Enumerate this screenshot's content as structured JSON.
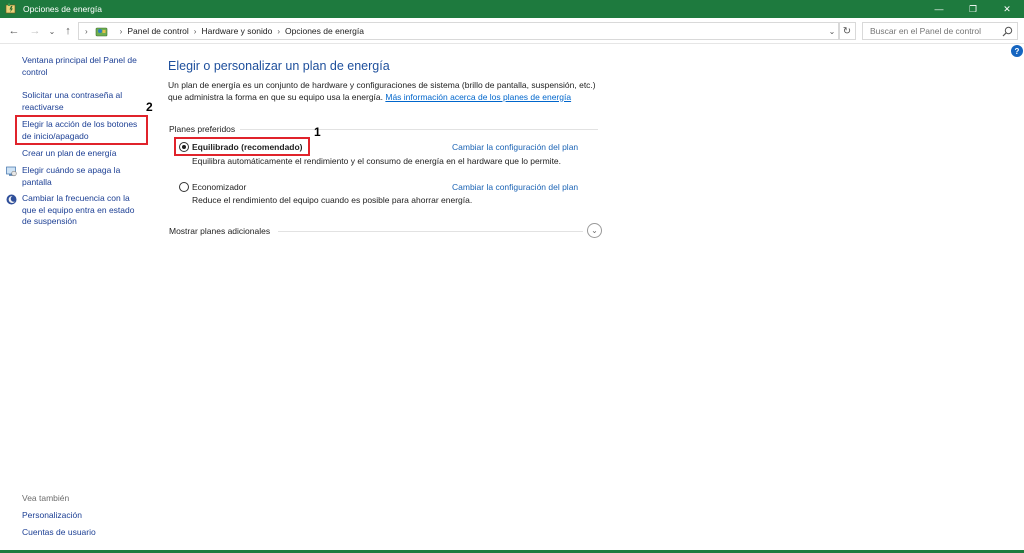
{
  "window": {
    "title": "Opciones de energía",
    "minimize": "—",
    "maximize": "❐",
    "close": "✕",
    "accent": "#1e7a3e"
  },
  "address": {
    "back": "←",
    "forward": "→",
    "history": "⌄",
    "up": "↑",
    "breadcrumbs": [
      "Panel de control",
      "Hardware y sonido",
      "Opciones de energía"
    ],
    "dropdown": "⌄",
    "refresh": "↻",
    "search_placeholder": "Buscar en el Panel de control"
  },
  "sidebar": {
    "items": [
      {
        "label": "Ventana principal del Panel de control",
        "icon": null
      },
      {
        "label": "Solicitar una contraseña al reactivarse",
        "icon": null
      },
      {
        "label": "Elegir la acción de los botones de inicio/apagado",
        "icon": null
      },
      {
        "label": "Crear un plan de energía",
        "icon": null
      },
      {
        "label": "Elegir cuándo se apaga la pantalla",
        "icon": "monitor-icon"
      },
      {
        "label": "Cambiar la frecuencia con la que el equipo entra en estado de suspensión",
        "icon": "moon-icon"
      }
    ],
    "see_also_title": "Vea también",
    "see_also": [
      "Personalización",
      "Cuentas de usuario"
    ]
  },
  "annotations": {
    "num1": "1",
    "num2": "2",
    "color": "#e0232b"
  },
  "main": {
    "title": "Elegir o personalizar un plan de energía",
    "description": "Un plan de energía es un conjunto de hardware y configuraciones de sistema (brillo de pantalla, suspensión, etc.) que administra la forma en que su equipo usa la energía.",
    "more_info_link": "Más información acerca de los planes de energía",
    "section_label": "Planes preferidos",
    "plans": [
      {
        "name": "Equilibrado (recomendado)",
        "selected": true,
        "description": "Equilibra automáticamente el rendimiento y el consumo de energía en el hardware que lo permite.",
        "link": "Cambiar la configuración del plan"
      },
      {
        "name": "Economizador",
        "selected": false,
        "description": "Reduce el rendimiento del equipo cuando es posible para ahorrar energía.",
        "link": "Cambiar la configuración del plan"
      }
    ],
    "more_plans": "Mostrar planes adicionales",
    "expand": "⌄",
    "help": "?"
  }
}
